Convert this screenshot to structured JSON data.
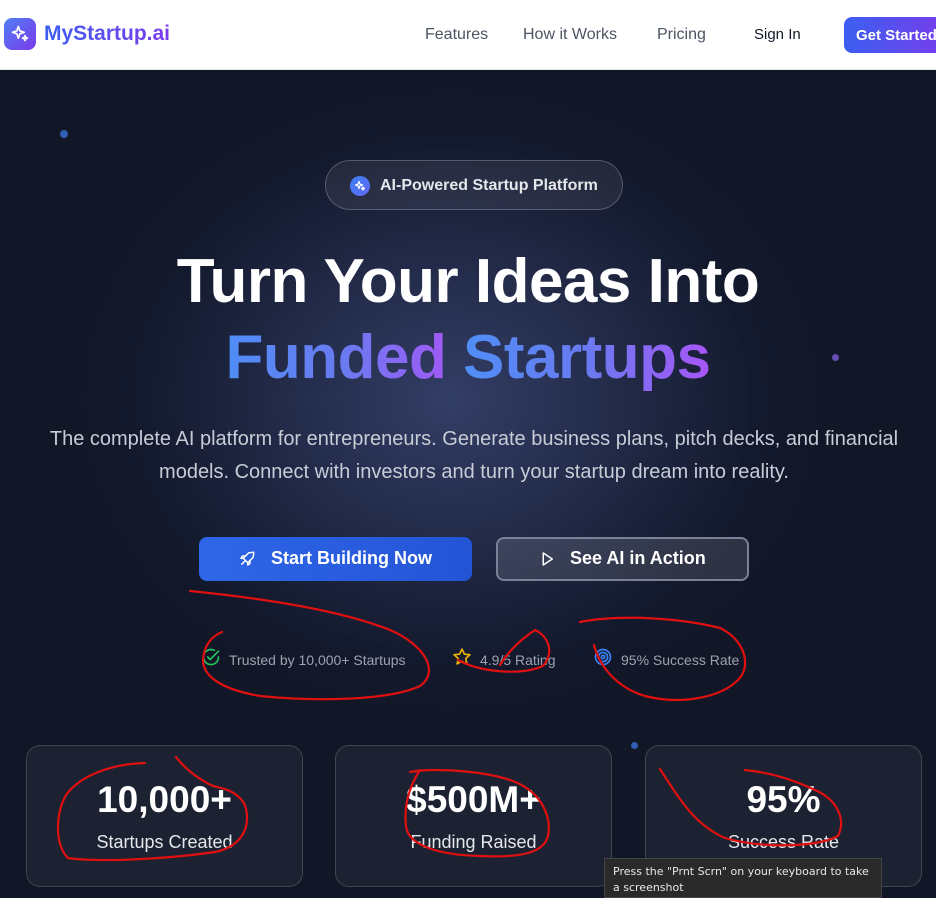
{
  "brand": {
    "name": "MyStartup.ai",
    "icon": "sparkles-icon"
  },
  "nav": {
    "links": [
      "Features",
      "How it Works",
      "Pricing"
    ],
    "sign_in": "Sign In",
    "cta": "Get Started"
  },
  "hero": {
    "badge": "AI-Powered Startup Platform",
    "headline_line1": "Turn Your Ideas Into",
    "headline_line2_part1": "Funded ",
    "headline_line2_part2": "Startups",
    "subtitle_line1": "The complete AI platform for entrepreneurs. Generate business plans, pitch decks, and financial",
    "subtitle_line2": "models. Connect with investors and turn your startup dream into reality.",
    "primary_button": "Start Building Now",
    "secondary_button": "See AI in Action"
  },
  "trust": [
    {
      "icon": "check-circle-icon",
      "text": "Trusted by 10,000+ Startups"
    },
    {
      "icon": "star-icon",
      "text": "4.9/5 Rating"
    },
    {
      "icon": "target-icon",
      "text": "95% Success Rate"
    }
  ],
  "stats": [
    {
      "value": "10,000+",
      "label": "Startups Created"
    },
    {
      "value": "$500M+",
      "label": "Funding Raised"
    },
    {
      "value": "95%",
      "label": "Success Rate"
    }
  ],
  "tooltip": "Press the \"Prnt Scrn\" on your keyboard to take a screenshot",
  "colors": {
    "accent_blue": "#2f66e8",
    "accent_purple": "#7c3aed",
    "annotation_red": "#e01010"
  }
}
